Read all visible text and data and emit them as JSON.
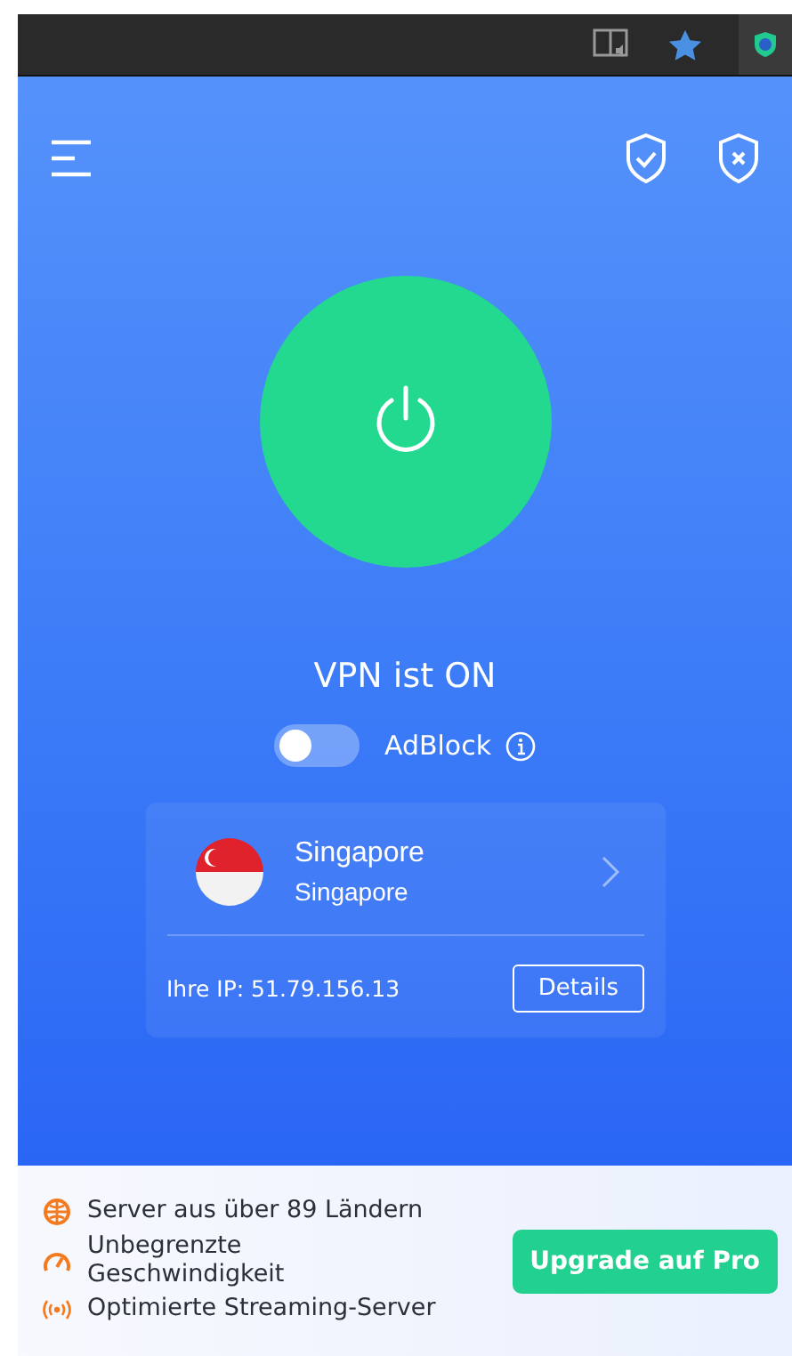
{
  "status": {
    "text": "VPN ist ON",
    "connected": true
  },
  "adblock": {
    "label": "AdBlock",
    "on": false
  },
  "location": {
    "country": "Singapore",
    "city": "Singapore"
  },
  "ip": {
    "text": "Ihre IP: 51.79.156.13",
    "button": "Details"
  },
  "features": [
    {
      "kind": "globe",
      "text": "Server aus über 89 Ländern"
    },
    {
      "kind": "speed",
      "text": "Unbegrenzte Geschwindigkeit"
    },
    {
      "kind": "stream",
      "text": "Optimierte Streaming-Server"
    }
  ],
  "upgrade": "Upgrade auf Pro"
}
